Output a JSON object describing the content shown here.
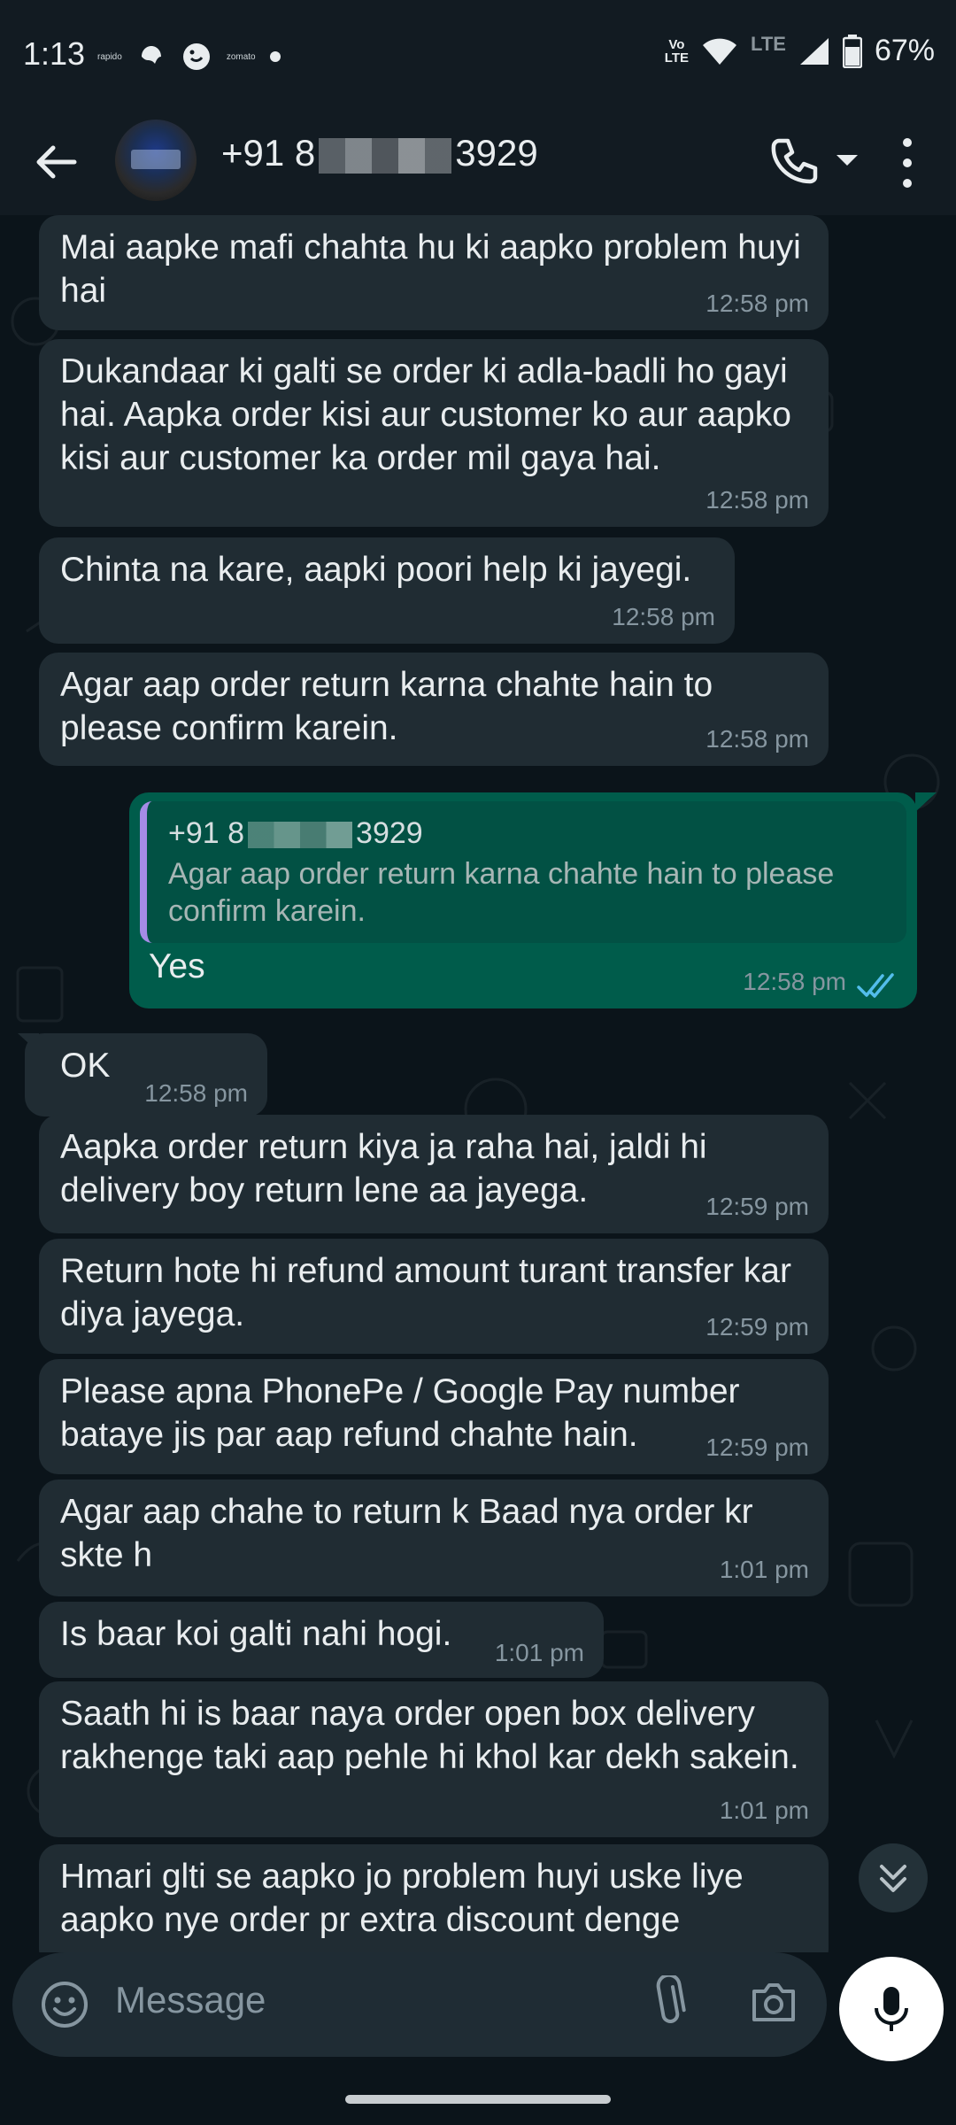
{
  "status_bar": {
    "time": "1:13",
    "apps": [
      "rapido",
      "zomato"
    ],
    "network": "Vo LTE",
    "network_line1": "Vo",
    "network_line2": "LTE",
    "lte": "LTE",
    "battery": "67%"
  },
  "header": {
    "contact_prefix": "+91 8",
    "contact_suffix": "3929"
  },
  "messages": [
    {
      "text": "Mai aapke mafi chahta hu ki aapko problem huyi hai",
      "time": "12:58 pm"
    },
    {
      "text": "Dukandaar ki galti se order ki adla-badli ho gayi hai. Aapka order kisi aur customer ko aur aapko kisi aur customer ka order mil gaya hai.",
      "time": "12:58 pm"
    },
    {
      "text": "Chinta na kare, aapki poori help ki jayegi.",
      "time": "12:58 pm"
    },
    {
      "text": "Agar aap order return karna chahte hain to please confirm karein.",
      "time": "12:58 pm"
    },
    {
      "text": "Yes",
      "time": "12:58 pm",
      "quoted_prefix": "+91 8",
      "quoted_suffix": "3929",
      "quoted_text": "Agar aap order return karna chahte hain to please confirm karein."
    },
    {
      "text": "OK",
      "time": "12:58 pm"
    },
    {
      "text": "Aapka order return kiya ja raha hai, jaldi hi delivery boy return lene aa jayega.",
      "time": "12:59 pm"
    },
    {
      "text": "Return hote hi refund amount turant transfer kar diya jayega.",
      "time": "12:59 pm"
    },
    {
      "text": "Please apna PhonePe / Google Pay number bataye jis par aap refund chahte hain.",
      "time": "12:59 pm"
    },
    {
      "text": "Agar aap chahe to return k Baad nya order kr skte h",
      "time": "1:01 pm"
    },
    {
      "text": "Is baar koi galti nahi hogi.",
      "time": "1:01 pm"
    },
    {
      "text": "Saath hi is baar naya order open box delivery rakhenge taki aap pehle hi khol kar dekh sakein.",
      "time": "1:01 pm"
    },
    {
      "text": "Hmari glti se aapko jo problem huyi uske liye aapko nye order pr extra discount denge",
      "time": ""
    }
  ],
  "composer": {
    "placeholder": "Message"
  },
  "colors": {
    "background": "#0b141a",
    "incoming_bubble": "#202c33",
    "outgoing_bubble": "#005c4b",
    "read_ticks": "#53bdeb"
  },
  "icons": [
    "back-arrow-icon",
    "phone-icon",
    "caret-down-icon",
    "more-vert-icon",
    "emoji-icon",
    "attach-icon",
    "camera-icon",
    "mic-icon",
    "double-chevron-down-icon",
    "double-check-icon"
  ]
}
